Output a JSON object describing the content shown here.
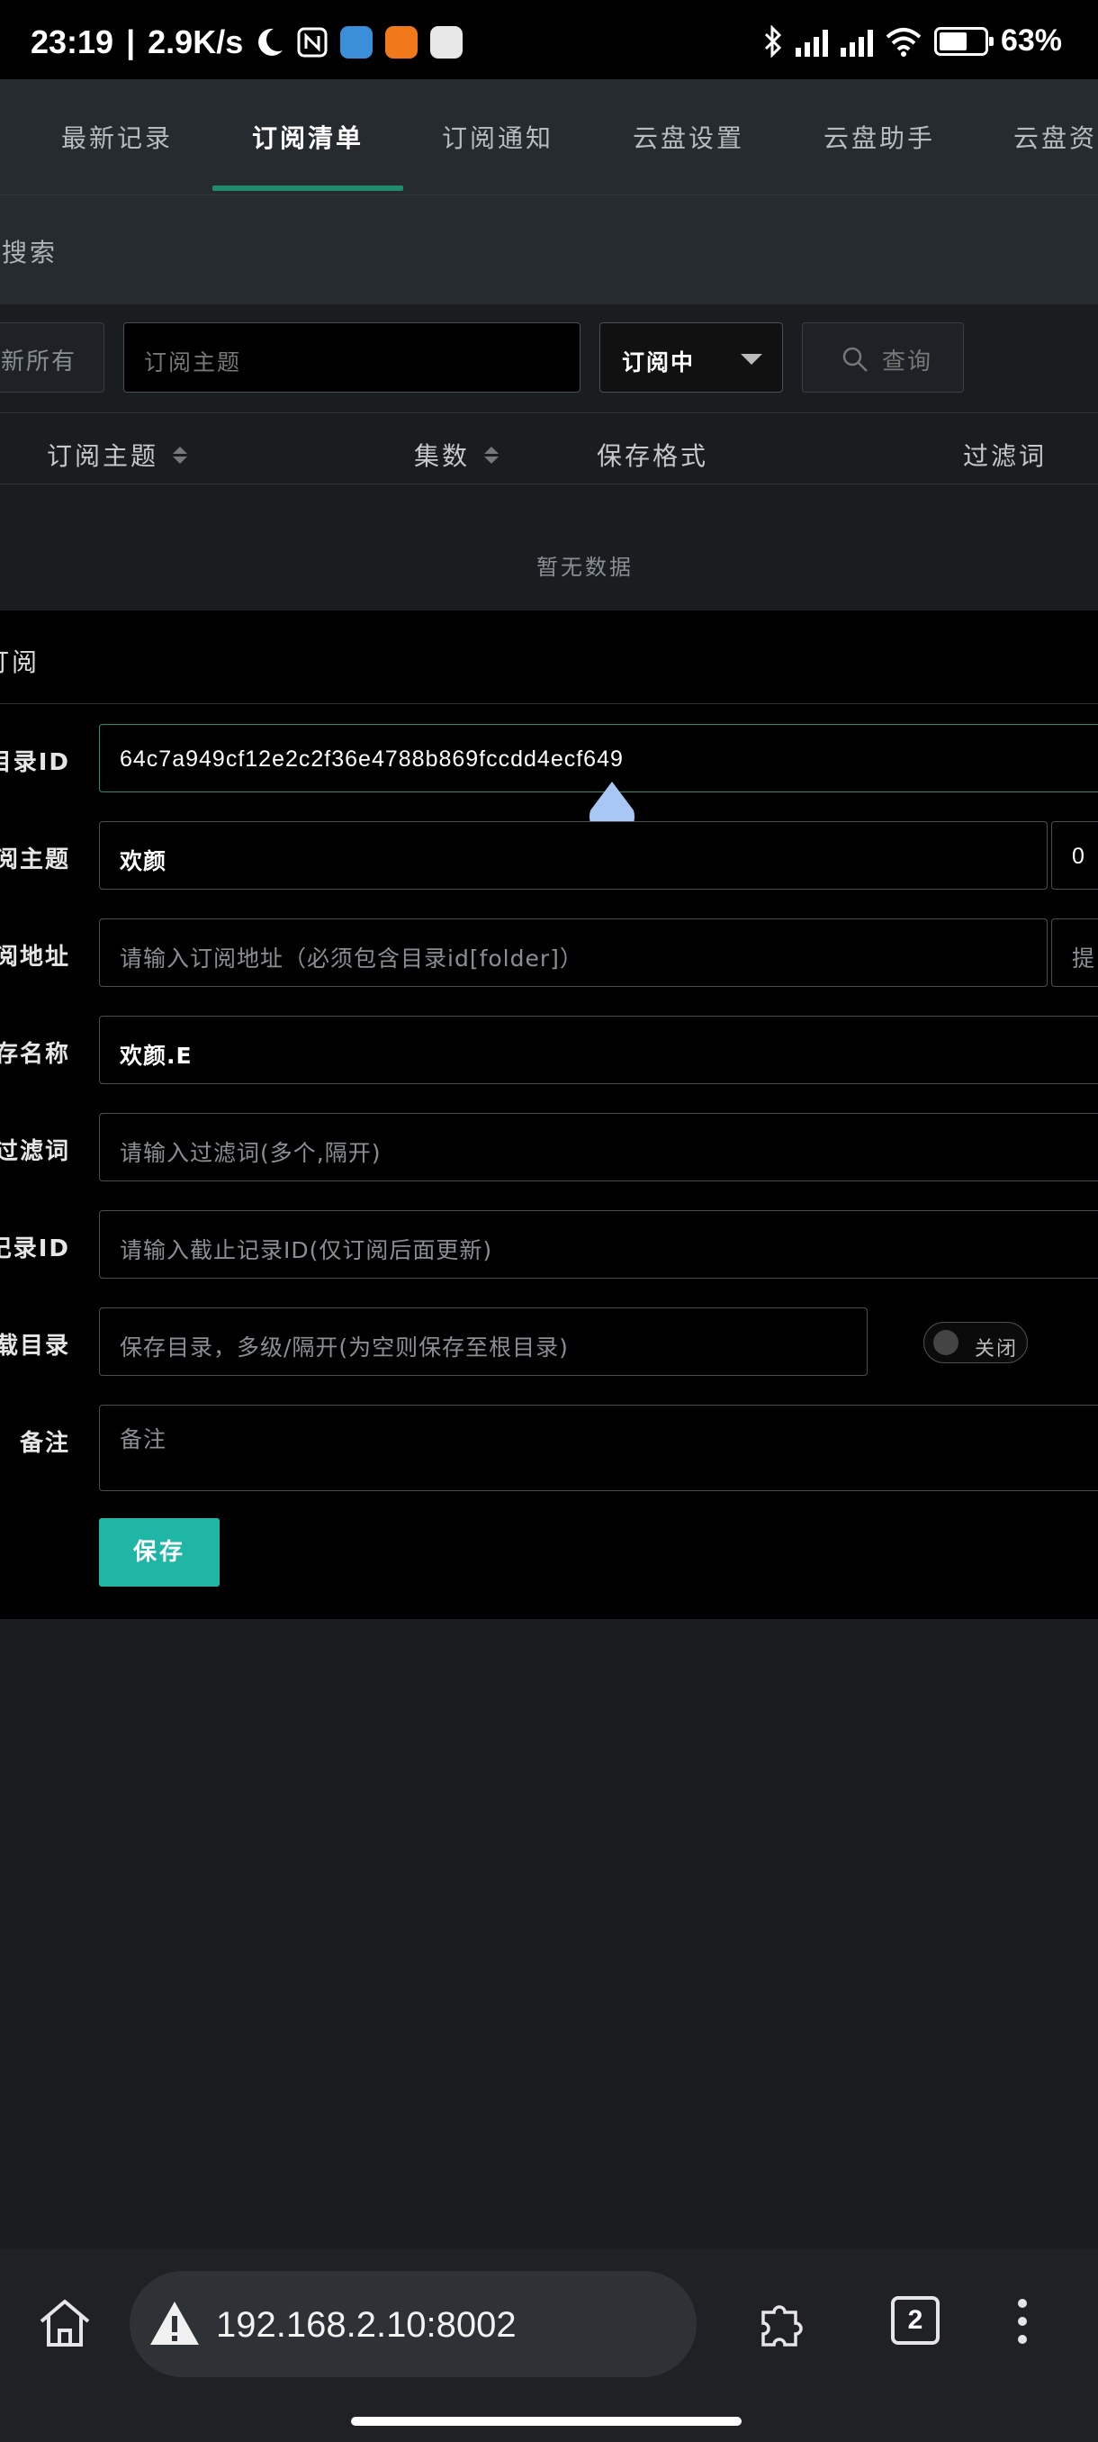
{
  "status_bar": {
    "time": "23:19",
    "net_speed": "2.9K/s",
    "battery": "63%",
    "battery_level": 0.63
  },
  "tabs": [
    {
      "label": "最新记录"
    },
    {
      "label": "订阅清单",
      "active": true
    },
    {
      "label": "订阅通知"
    },
    {
      "label": "云盘设置"
    },
    {
      "label": "云盘助手"
    },
    {
      "label": "云盘资"
    }
  ],
  "search_section": {
    "title": "搜索"
  },
  "filters": {
    "refresh_label": "新所有",
    "topic_placeholder": "订阅主题",
    "status_selected": "订阅中",
    "query_label": "查询"
  },
  "table": {
    "columns": [
      "订阅主题",
      "集数",
      "保存格式",
      "过滤词"
    ],
    "empty_text": "暂无数据"
  },
  "form": {
    "title": "订阅",
    "fields": {
      "dir_id": {
        "label": "目录ID",
        "value": "64c7a949cf12e2c2f36e4788b869fccdd4ecf649"
      },
      "topic": {
        "label": "阅主题",
        "value": "欢颜",
        "suffix_value": "0"
      },
      "url": {
        "label": "阅地址",
        "placeholder": "请输入订阅地址（必须包含目录id[folder]）",
        "suffix_label": "提"
      },
      "save_name": {
        "label": "存名称",
        "value": "欢颜.E"
      },
      "filter": {
        "label": "过滤词",
        "placeholder": "请输入过滤词(多个,隔开)"
      },
      "stop_id": {
        "label": "记录ID",
        "placeholder": "请输入截止记录ID(仅订阅后面更新)"
      },
      "save_dir": {
        "label": "载目录",
        "placeholder": "保存目录，多级/隔开(为空则保存至根目录)"
      },
      "note": {
        "label": "备注",
        "placeholder": "备注"
      }
    },
    "toggle_label": "关闭",
    "save_button": "保存"
  },
  "browser": {
    "url": "192.168.2.10:8002",
    "tab_count": "2"
  },
  "colors": {
    "accent_green": "#1f8c6e",
    "save_button": "#1fb6a6",
    "tab_bg": "#262b30"
  }
}
